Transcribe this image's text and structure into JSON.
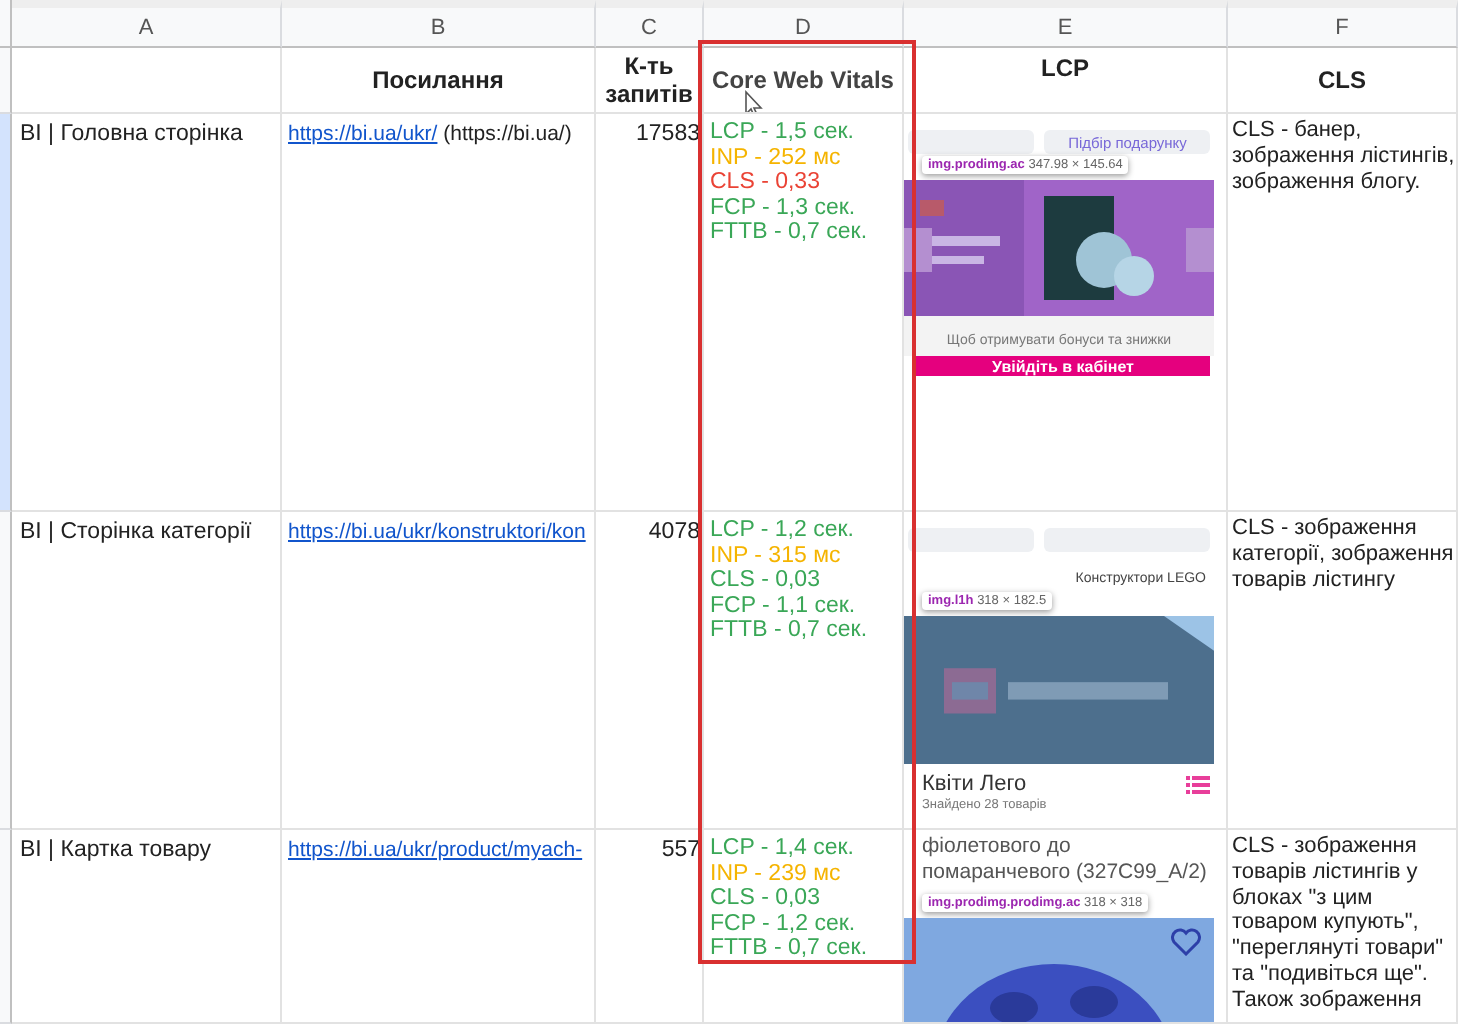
{
  "columns": [
    "A",
    "B",
    "C",
    "D",
    "E",
    "F"
  ],
  "header": {
    "link": "Посилання",
    "requests": "К-ть запитів",
    "vitals": "Core Web Vitals",
    "lcp": "LCP",
    "cls": "CLS"
  },
  "rows": [
    {
      "page": "BI | Головна сторінка",
      "link": "https://bi.ua/ukr/",
      "link_suffix": " (https://bi.ua/)",
      "requests": "17583",
      "vitals": [
        {
          "text": "LCP - 1,5 сек.",
          "color": "#3aa757"
        },
        {
          "text": "INP - 252 мс",
          "color": "#f5b400"
        },
        {
          "text": "CLS - 0,33",
          "color": "#ea4335"
        },
        {
          "text": "FCP - 1,3 сек.",
          "color": "#3aa757"
        },
        {
          "text": "FTTB - 0,7 сек.",
          "color": "#3aa757"
        }
      ],
      "shot": {
        "kind": "banner",
        "top_button": "Підбір подарунку",
        "tooltip": "img.prodimg.ac",
        "size": "347.98 × 145.64",
        "caption": "Щоб отримувати бонуси та знижки",
        "action": "Увійдіть в кабінет"
      },
      "cls_note": "CLS - банер, зображення лістингів, зображення блогу."
    },
    {
      "page": "BI | Сторінка категорії",
      "link": "https://bi.ua/ukr/konstruktori/kon",
      "requests": "4078",
      "vitals": [
        {
          "text": "LCP - 1,2 сек.",
          "color": "#3aa757"
        },
        {
          "text": "INP - 315 мс",
          "color": "#f5b400"
        },
        {
          "text": "CLS - 0,03",
          "color": "#3aa757"
        },
        {
          "text": "FCP - 1,1 сек.",
          "color": "#3aa757"
        },
        {
          "text": "FTTB - 0,7 сек.",
          "color": "#3aa757"
        }
      ],
      "shot": {
        "kind": "category",
        "breadcrumb": "Конструктори LEGO",
        "tooltip": "img.l1h",
        "size": "318 × 182.5",
        "title": "Квіти Лего",
        "caption": "Знайдено 28 товарів"
      },
      "cls_note": "CLS - зображення категорії, зображення товарів лістингу"
    },
    {
      "page": "BI | Картка товару",
      "link": "https://bi.ua/ukr/product/myach-",
      "requests": "557",
      "vitals": [
        {
          "text": "LCP - 1,4 сек.",
          "color": "#3aa757"
        },
        {
          "text": "INP - 239 мс",
          "color": "#f5b400"
        },
        {
          "text": "CLS - 0,03",
          "color": "#3aa757"
        },
        {
          "text": "FCP - 1,2 сек.",
          "color": "#3aa757"
        },
        {
          "text": "FTTB - 0,7 сек.",
          "color": "#3aa757"
        }
      ],
      "shot": {
        "kind": "product",
        "title": "фіолетового до помаранчевого (327C99_A/2)",
        "tooltip": "img.prodimg.prodimg.ac",
        "size": "318 × 318"
      },
      "cls_note": "CLS - зображення товарів лістингів у блоках \"з цим товаром купують\", \"переглянуті товари\" та \"подивіться ще\". Також зображення"
    }
  ]
}
